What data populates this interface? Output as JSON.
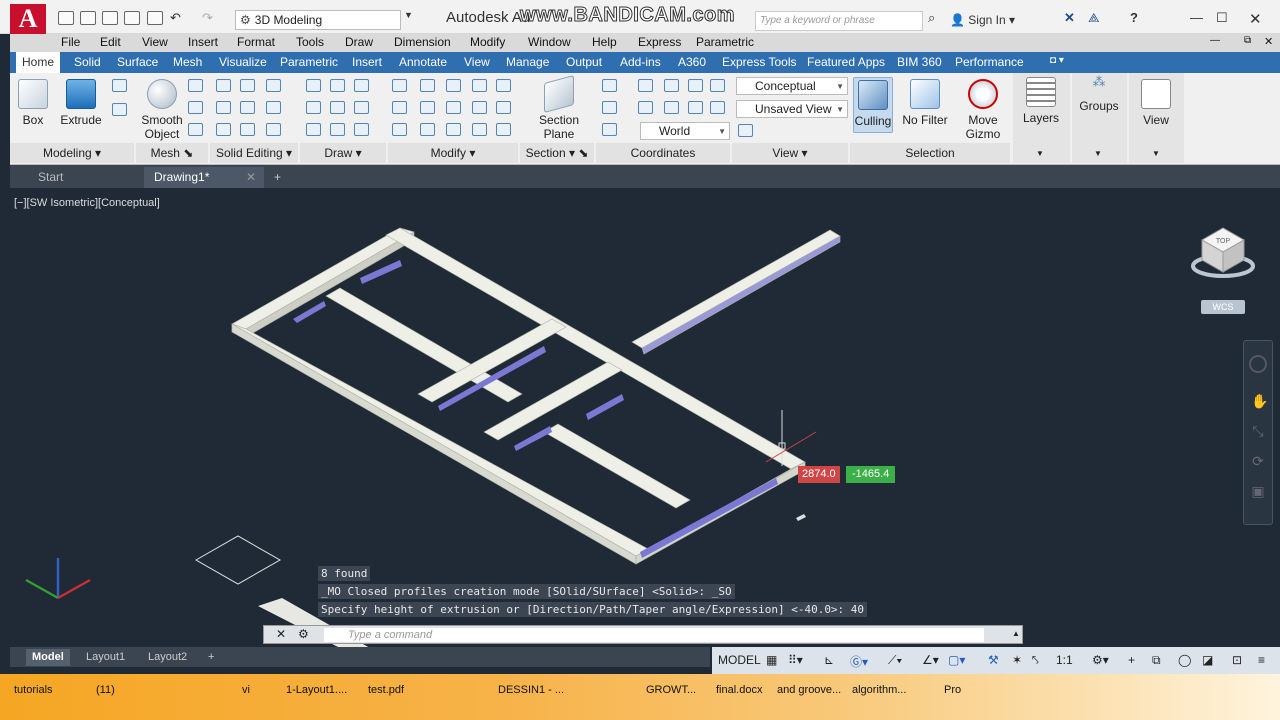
{
  "titlebar": {
    "app_title": "Autodesk Au",
    "watermark": "www.BANDICAM.com",
    "workspace": "3D Modeling",
    "search_placeholder": "Type a keyword or phrase",
    "sign_in": "Sign In",
    "help": "?"
  },
  "menu": [
    "File",
    "Edit",
    "View",
    "Insert",
    "Format",
    "Tools",
    "Draw",
    "Dimension",
    "Modify",
    "Window",
    "Help",
    "Express",
    "Parametric"
  ],
  "ribbon_tabs": [
    "Home",
    "Solid",
    "Surface",
    "Mesh",
    "Visualize",
    "Parametric",
    "Insert",
    "Annotate",
    "View",
    "Manage",
    "Output",
    "Add-ins",
    "A360",
    "Express Tools",
    "Featured Apps",
    "BIM 360",
    "Performance"
  ],
  "ribbon": {
    "box": "Box",
    "extrude": "Extrude",
    "smooth_object": [
      "Smooth",
      "Object"
    ],
    "section_plane": [
      "Section",
      "Plane"
    ],
    "visual_style": "Conceptual",
    "saved_view": "Unsaved View",
    "ucs": "World",
    "culling": "Culling",
    "no_filter": "No Filter",
    "move_gizmo": [
      "Move",
      "Gizmo"
    ],
    "layers": "Layers",
    "groups": "Groups",
    "view": "View"
  },
  "panels": [
    "Modeling",
    "Mesh",
    "Solid Editing",
    "Draw",
    "Modify",
    "Section",
    "Coordinates",
    "View",
    "Selection"
  ],
  "doc_tabs": {
    "start": "Start",
    "drawing": "Drawing1*"
  },
  "viewport": {
    "label": "[−][SW Isometric][Conceptual]",
    "wcs": "WCS",
    "cube_top": "TOP",
    "dyn_x": "2874.0",
    "dyn_y": "-1465.4"
  },
  "command": {
    "history": [
      "8 found",
      "_MO Closed profiles creation mode [SOlid/SUrface] <Solid>: _SO",
      "Specify height of extrusion or [Direction/Path/Taper angle/Expression] <-40.0>: 40"
    ],
    "placeholder": "Type a command"
  },
  "layout_tabs": [
    "Model",
    "Layout1",
    "Layout2"
  ],
  "status": {
    "model": "MODEL",
    "scale": "1:1"
  },
  "taskbar": [
    "tutorials",
    "(11)",
    "vi",
    "1-Layout1....",
    "test.pdf",
    "DESSIN1 - ...",
    "GROWT...",
    "final.docx",
    "and groove...",
    "algorithm...",
    "Pro"
  ],
  "colors": {
    "accent": "#2f6fb0",
    "canvas": "#1f2a36",
    "logo": "#c8102e"
  }
}
